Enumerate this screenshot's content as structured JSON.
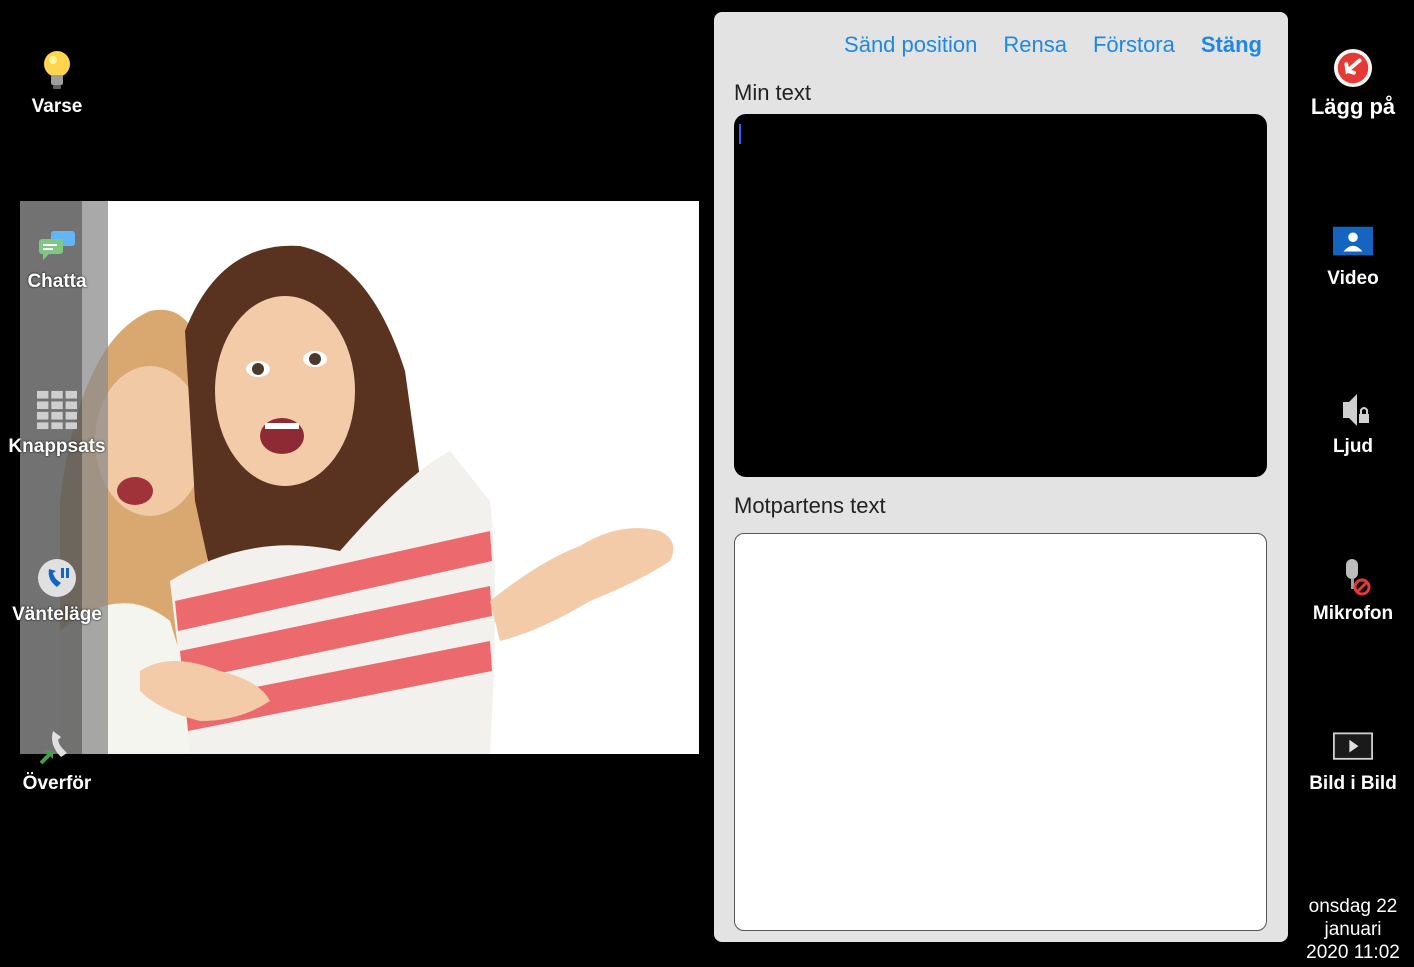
{
  "left_buttons": [
    {
      "label": "Varse",
      "icon": "lightbulb-icon"
    },
    {
      "label": "Chatta",
      "icon": "chat-icon"
    },
    {
      "label": "Knappsats",
      "icon": "keypad-icon"
    },
    {
      "label": "Vänteläge",
      "icon": "hold-icon"
    },
    {
      "label": "Överför",
      "icon": "transfer-icon"
    }
  ],
  "right_buttons": [
    {
      "label": "Lägg på",
      "icon": "hangup-icon"
    },
    {
      "label": "Video",
      "icon": "video-icon"
    },
    {
      "label": "Ljud",
      "icon": "speaker-lock-icon"
    },
    {
      "label": "Mikrofon",
      "icon": "mic-muted-icon"
    },
    {
      "label": "Bild i Bild",
      "icon": "picture-in-picture-icon"
    }
  ],
  "chat": {
    "links": {
      "send_position": "Sänd position",
      "clear": "Rensa",
      "enlarge": "Förstora",
      "close": "Stäng"
    },
    "my_text_label": "Min text",
    "my_text_value": "",
    "their_text_label": "Motpartens text",
    "their_text_value": ""
  },
  "datetime": {
    "line1": "onsdag 22",
    "line2": "januari",
    "line3": "2020 11:02"
  },
  "colors": {
    "link": "#1e88e5",
    "background": "#000000",
    "panel": "#e3e3e3",
    "hangup": "#e53935"
  }
}
